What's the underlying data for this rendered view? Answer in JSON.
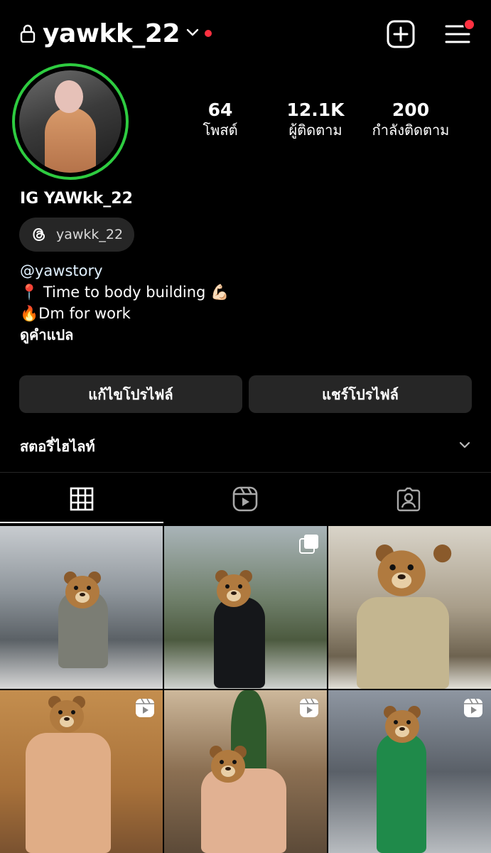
{
  "header": {
    "username": "yawkk_22"
  },
  "stats": [
    {
      "value": "64",
      "label": "โพสต์"
    },
    {
      "value": "12.1K",
      "label": "ผู้ติดตาม"
    },
    {
      "value": "200",
      "label": "กำลังติดตาม"
    }
  ],
  "profile": {
    "display_name": "IG YAWkk_22",
    "threads_handle": "yawkk_22",
    "bio": [
      "@yawstory",
      "📍 Time to body building 💪🏻",
      "🔥Dm for work",
      "ดูคำแปล"
    ]
  },
  "buttons": {
    "edit": "แก้ไขโปรไฟล์",
    "share": "แชร์โปรไฟล์"
  },
  "highlights": {
    "title": "สตอรี่ไฮไลท์"
  },
  "tabs": [
    {
      "icon": "grid-icon",
      "active": true
    },
    {
      "icon": "reels-icon",
      "active": false
    },
    {
      "icon": "tagged-icon",
      "active": false
    }
  ],
  "grid": [
    {
      "badge": "none"
    },
    {
      "badge": "carousel"
    },
    {
      "badge": "none"
    },
    {
      "badge": "reel"
    },
    {
      "badge": "reel"
    },
    {
      "badge": "reel"
    }
  ],
  "colors": {
    "story_ring": "#2ecc40",
    "notification": "#ff3040",
    "button_bg": "#262626"
  }
}
